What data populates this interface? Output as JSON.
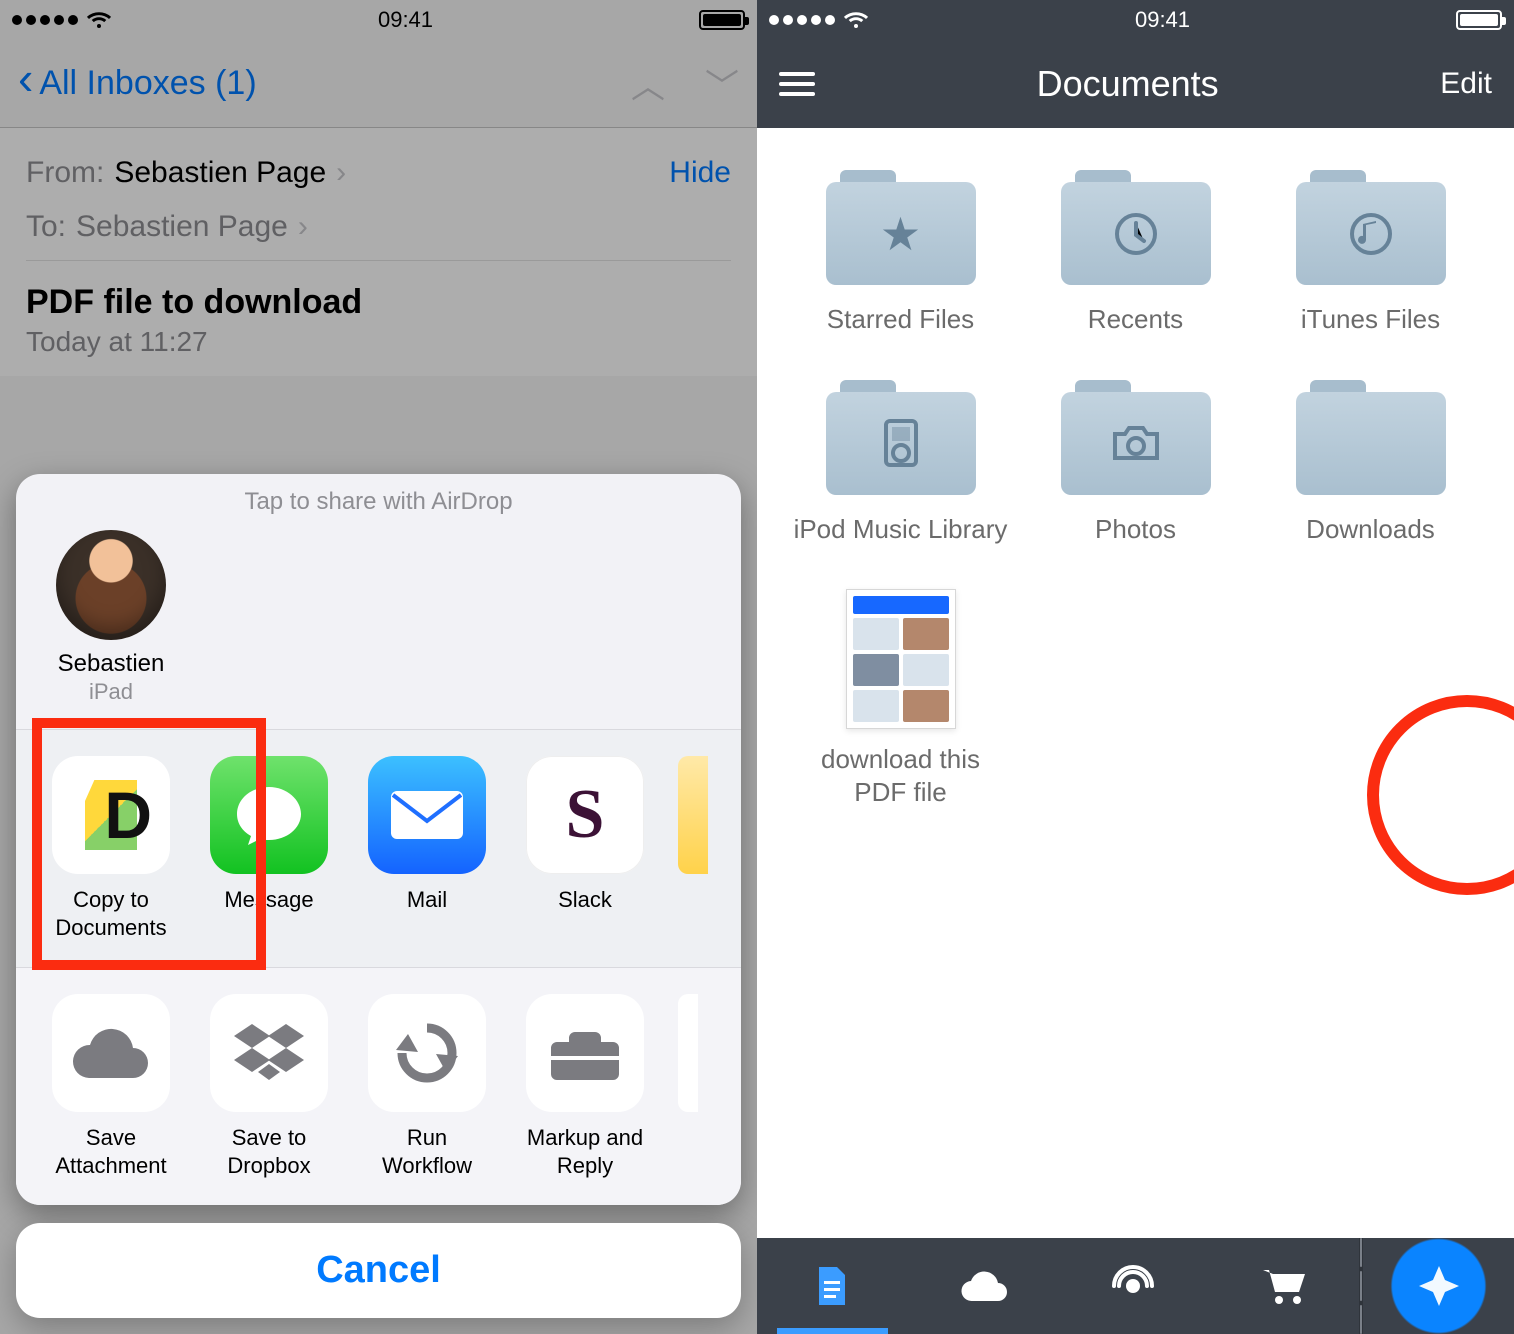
{
  "status": {
    "time": "09:41"
  },
  "mail": {
    "back_label": "All Inboxes (1)",
    "from_label": "From:",
    "from_value": "Sebastien Page",
    "to_label": "To:",
    "to_value": "Sebastien Page",
    "hide_label": "Hide",
    "subject": "PDF file to download",
    "timestamp": "Today at 11:27"
  },
  "share_sheet": {
    "airdrop_title": "Tap to share with AirDrop",
    "airdrop": [
      {
        "name": "Sebastien",
        "device": "iPad"
      }
    ],
    "apps": [
      {
        "label": "Copy to Documents"
      },
      {
        "label": "Message"
      },
      {
        "label": "Mail"
      },
      {
        "label": "Slack"
      }
    ],
    "actions": [
      {
        "label": "Save Attachment"
      },
      {
        "label": "Save to Dropbox"
      },
      {
        "label": "Run Workflow"
      },
      {
        "label": "Markup and Reply"
      }
    ],
    "cancel_label": "Cancel"
  },
  "documents": {
    "title": "Documents",
    "edit_label": "Edit",
    "folders": [
      {
        "label": "Starred Files",
        "icon": "star"
      },
      {
        "label": "Recents",
        "icon": "clock"
      },
      {
        "label": "iTunes Files",
        "icon": "music-note"
      },
      {
        "label": "iPod Music Library",
        "icon": "ipod"
      },
      {
        "label": "Photos",
        "icon": "camera"
      },
      {
        "label": "Downloads",
        "icon": ""
      }
    ],
    "files": [
      {
        "label": "download this PDF file"
      }
    ],
    "tabs": [
      "documents",
      "cloud",
      "wifi",
      "store",
      "browser"
    ]
  }
}
